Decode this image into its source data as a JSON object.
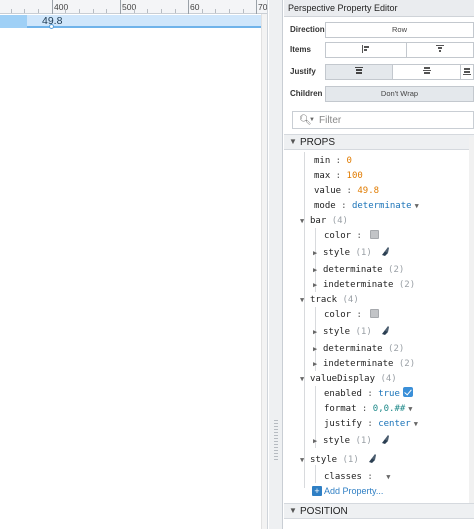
{
  "ruler": {
    "ticks": [
      "400",
      "500",
      "60",
      "70"
    ]
  },
  "progress_bar": {
    "value_text": "49.8",
    "value": 49.8,
    "min": 0,
    "max": 100
  },
  "editor": {
    "title": "Perspective Property Editor",
    "layout": {
      "direction_label": "Direction",
      "direction_value": "Row",
      "items_label": "Items",
      "justify_label": "Justify",
      "children_label": "Children",
      "children_value": "Don't Wrap"
    },
    "search": {
      "placeholder": "Filter"
    },
    "props_section": "PROPS",
    "position_section": "POSITION",
    "add_property": "Add Property..."
  },
  "props": {
    "min": {
      "key": "min",
      "value": "0"
    },
    "max": {
      "key": "max",
      "value": "100"
    },
    "value": {
      "key": "value",
      "value": "49.8"
    },
    "mode": {
      "key": "mode",
      "value": "determinate"
    },
    "bar": {
      "key": "bar",
      "count": "(4)",
      "color": "color",
      "style": "style",
      "style_count": "(1)",
      "determinate": "determinate",
      "determinate_count": "(2)",
      "indeterminate": "indeterminate",
      "indeterminate_count": "(2)"
    },
    "track": {
      "key": "track",
      "count": "(4)",
      "color": "color",
      "style": "style",
      "style_count": "(1)",
      "determinate": "determinate",
      "determinate_count": "(2)",
      "indeterminate": "indeterminate",
      "indeterminate_count": "(2)"
    },
    "valueDisplay": {
      "key": "valueDisplay",
      "count": "(4)",
      "enabled": "enabled",
      "enabled_value": "true",
      "format": "format",
      "format_value": "0,0.##",
      "justify": "justify",
      "justify_value": "center",
      "style": "style",
      "style_count": "(1)"
    },
    "style": {
      "key": "style",
      "count": "(1)",
      "classes": "classes"
    }
  },
  "colors": {
    "accent": "#3a8fd8",
    "number": "#e07b00",
    "keyword": "#1a73b8",
    "string": "#1f8a8a",
    "progress": "#9fd0f6"
  }
}
